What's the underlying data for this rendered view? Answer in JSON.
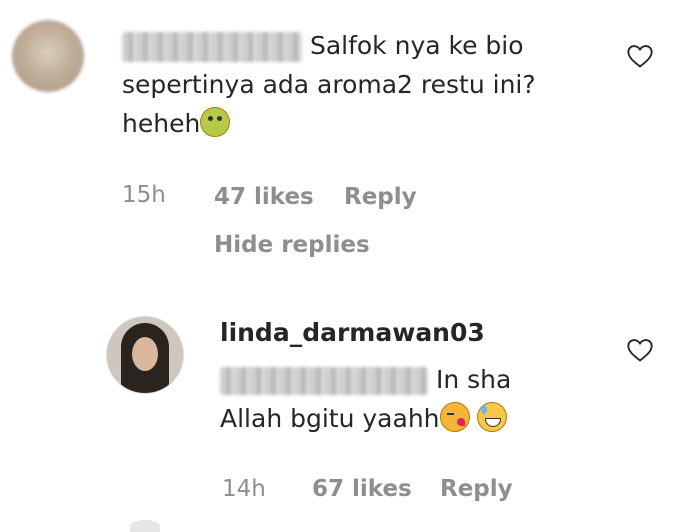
{
  "comment1": {
    "text_line1": "Salfok nya ke bio",
    "text_line2": "sepertinya ada aroma2 restu ini?",
    "text_line3": "heheh",
    "time": "15h",
    "likes": "47 likes",
    "reply": "Reply",
    "hide_replies": "Hide replies"
  },
  "reply1": {
    "username": "linda_darmawan03",
    "text_line1": "In sha",
    "text_line2": "Allah bgitu yaahh",
    "time": "14h",
    "likes": "67 likes",
    "reply": "Reply"
  },
  "colors": {
    "text": "#262626",
    "meta": "#8e8e8e"
  },
  "icons": {
    "like": "heart-outline-icon",
    "emoji_1": "sick-face-emoji",
    "emoji_2": "winking-kiss-face-emoji",
    "emoji_3": "grinning-sweat-face-emoji"
  }
}
